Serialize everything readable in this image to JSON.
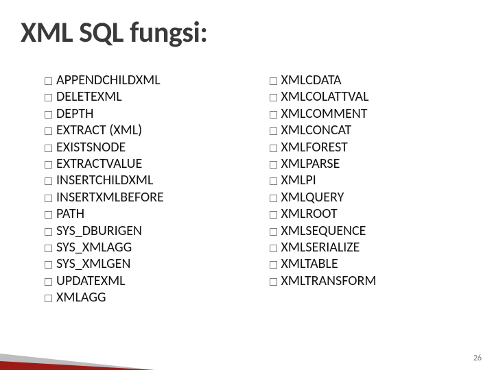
{
  "title": "XML SQL fungsi:",
  "left": {
    "items": [
      "APPENDCHILDXML",
      "DELETEXML",
      "DEPTH",
      "EXTRACT (XML)",
      "EXISTSNODE",
      "EXTRACTVALUE",
      "INSERTCHILDXML",
      "INSERTXMLBEFORE",
      "PATH",
      "SYS_DBURIGEN",
      "SYS_XMLAGG",
      "SYS_XMLGEN",
      "UPDATEXML",
      "XMLAGG"
    ]
  },
  "right": {
    "items": [
      "XMLCDATA",
      "XMLCOLATTVAL",
      "XMLCOMMENT",
      "XMLCONCAT",
      "XMLFOREST",
      "XMLPARSE",
      "XMLPI",
      "XMLQUERY",
      "XMLROOT",
      "XMLSEQUENCE",
      "XMLSERIALIZE",
      "XMLTABLE",
      "XMLTRANSFORM"
    ]
  },
  "page_number": "26"
}
